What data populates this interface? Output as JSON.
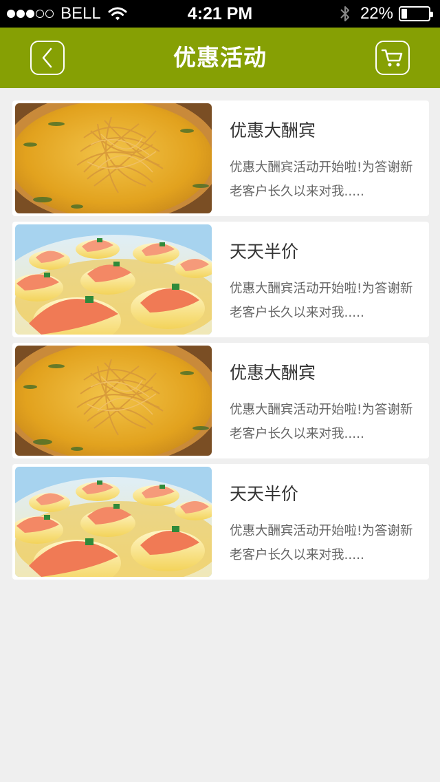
{
  "status_bar": {
    "carrier": "BELL",
    "time": "4:21 PM",
    "battery": "22%",
    "battery_level": 0.22
  },
  "nav": {
    "title": "优惠活动",
    "back_icon": "chevron-left-icon",
    "cart_icon": "shopping-cart-icon"
  },
  "colors": {
    "nav_green": "#86a004",
    "background": "#efefef"
  },
  "promotions": [
    {
      "title": "优惠大酬宾",
      "description": "优惠大酬宾活动开始啦!为答谢新老客户长久以来对我.....",
      "image": "noodle-soup"
    },
    {
      "title": "天天半价",
      "description": "优惠大酬宾活动开始啦!为答谢新老客户长久以来对我.....",
      "image": "shrimp-tofu"
    },
    {
      "title": "优惠大酬宾",
      "description": "优惠大酬宾活动开始啦!为答谢新老客户长久以来对我.....",
      "image": "noodle-soup"
    },
    {
      "title": "天天半价",
      "description": "优惠大酬宾活动开始啦!为答谢新老客户长久以来对我.....",
      "image": "shrimp-tofu"
    }
  ]
}
